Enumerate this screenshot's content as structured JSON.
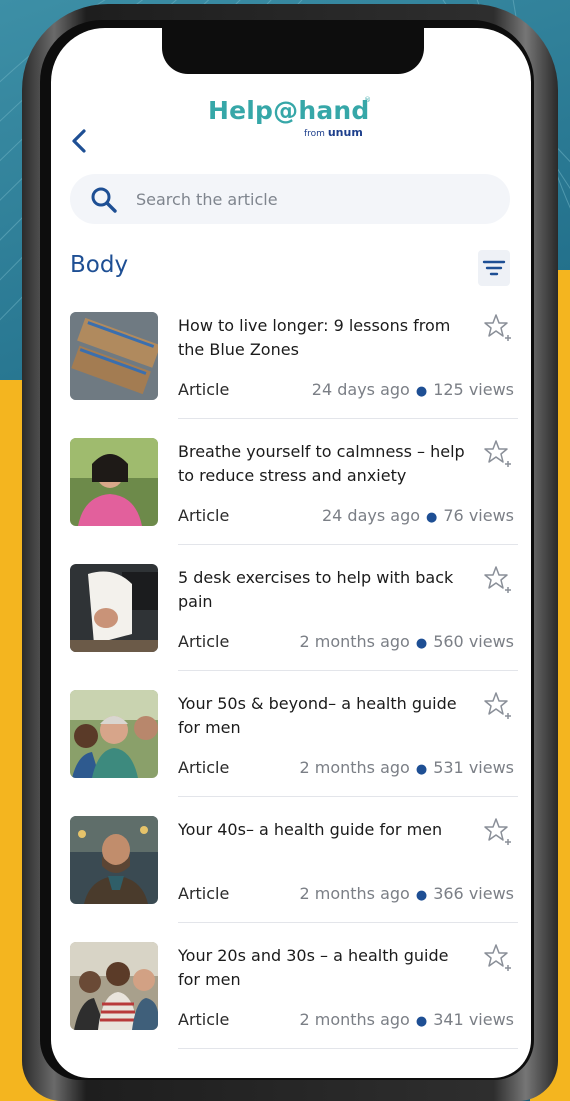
{
  "header": {
    "logo_text": "Help@hand",
    "logo_registered": "®",
    "logo_from": "from",
    "logo_brand": "unum",
    "back_icon": "chevron-left-icon"
  },
  "search": {
    "placeholder": "Search the article",
    "value": ""
  },
  "section": {
    "title": "Body",
    "filter_icon": "filter-icon"
  },
  "colors": {
    "brand_teal": "#36a7a8",
    "brand_blue": "#1e4f94",
    "accent_yellow": "#f4b51f"
  },
  "articles": [
    {
      "title": "How to live longer: 9 lessons from the Blue Zones",
      "type": "Article",
      "age": "24 days ago",
      "views": "125 views"
    },
    {
      "title": "Breathe yourself to calmness – help to reduce stress and anxiety",
      "type": "Article",
      "age": "24 days ago",
      "views": "76 views"
    },
    {
      "title": "5 desk exercises to help with back pain",
      "type": "Article",
      "age": "2 months ago",
      "views": "560 views"
    },
    {
      "title": "Your 50s & beyond– a health guide for men",
      "type": "Article",
      "age": "2 months ago",
      "views": "531 views"
    },
    {
      "title": "Your 40s– a health guide for men",
      "type": "Article",
      "age": "2 months ago",
      "views": "366 views"
    },
    {
      "title": "Your 20s and 30s – a health guide for men",
      "type": "Article",
      "age": "2 months ago",
      "views": "341 views"
    }
  ]
}
